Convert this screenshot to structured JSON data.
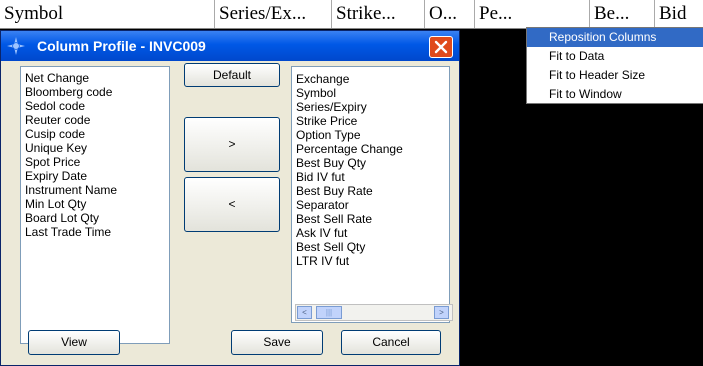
{
  "grid": {
    "columns": [
      "Symbol",
      "Series/Ex...",
      "Strike...",
      "O...",
      "Pe...",
      "Be...",
      "Bid"
    ]
  },
  "context_menu": {
    "items": [
      "Reposition Columns",
      "Fit to Data",
      "Fit to Header Size",
      "Fit to Window"
    ],
    "selected": "Reposition Columns"
  },
  "dialog": {
    "title": "Column Profile - INVC009",
    "available_columns": [
      "Net Change",
      "Bloomberg code",
      "Sedol code",
      "Reuter code",
      "Cusip code",
      "Unique Key",
      "Spot Price",
      "Expiry Date",
      "Instrument Name",
      "Min Lot Qty",
      "Board Lot Qty",
      "Last Trade Time"
    ],
    "selected_columns": [
      "Exchange",
      "Symbol",
      "Series/Expiry",
      "Strike Price",
      "Option Type",
      "Percentage Change",
      "Best Buy Qty",
      "Bid IV fut",
      "Best Buy Rate",
      "Separator",
      "Best Sell Rate",
      "Ask IV fut",
      "Best Sell Qty",
      "LTR IV fut"
    ],
    "buttons": {
      "default": "Default",
      "add": ">",
      "remove": "<",
      "view": "View",
      "save": "Save",
      "cancel": "Cancel"
    },
    "scrollbar": {
      "left_arrow": "<",
      "right_arrow": ">",
      "thumb_grip": "|||"
    }
  },
  "colors": {
    "titlebar": "#0058e6",
    "close_button": "#e04a1c",
    "dialog_bg": "#ece9d8",
    "menu_highlight": "#316ac5"
  }
}
